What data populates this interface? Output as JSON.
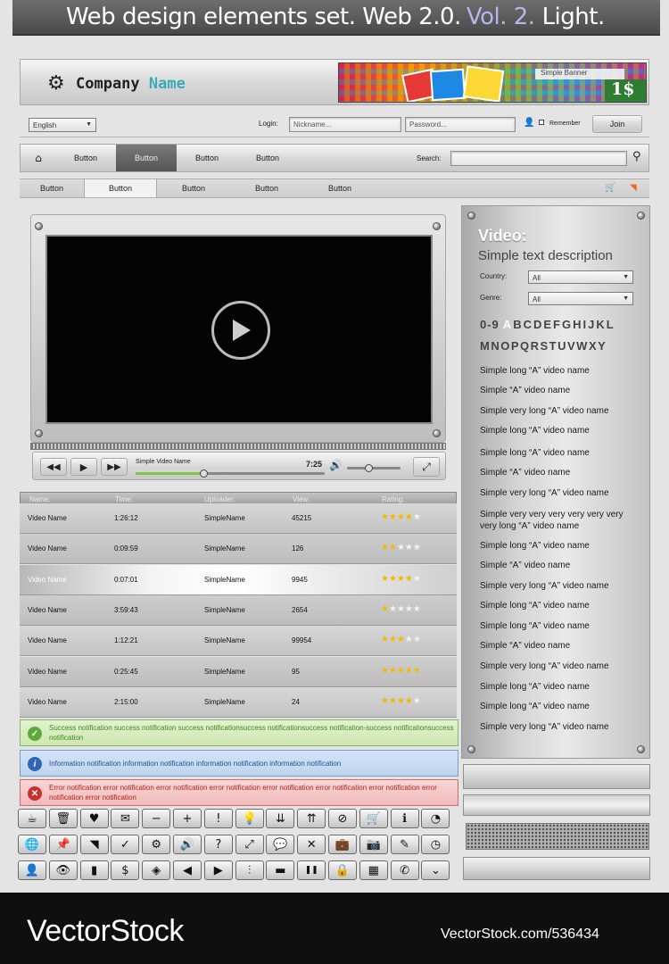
{
  "header": {
    "title_main": "Web design elements set. Web 2.0.",
    "title_vol": "Vol. 2.",
    "title_end": "Light."
  },
  "brand": {
    "company": "Company",
    "name": "Name",
    "banner_label": "Simple Banner",
    "banner_price": "1$"
  },
  "topbar": {
    "language": "English",
    "login_label": "Login:",
    "nickname_placeholder": "Nickname...",
    "password_placeholder": "Password...",
    "remember_label": "Remember",
    "join_label": "Join"
  },
  "nav1": {
    "items": [
      "Button",
      "Button",
      "Button",
      "Button"
    ],
    "active_index": 1,
    "search_label": "Search:"
  },
  "nav2": {
    "items": [
      "Button",
      "Button",
      "Button",
      "Button",
      "Button"
    ],
    "active_index": 1
  },
  "player": {
    "video_title": "Simple Video Name",
    "time": "7:25",
    "progress": 0.36,
    "volume": 0.4
  },
  "table": {
    "headers": [
      "Name:",
      "Time:",
      "Uploader:",
      "View:",
      "Rating:"
    ],
    "rows": [
      {
        "name": "Video Name",
        "time": "1:26:12",
        "uploader": "SimpleName",
        "views": "45215",
        "rating": 4
      },
      {
        "name": "Video Name",
        "time": "0:09:59",
        "uploader": "SimpleName",
        "views": "126",
        "rating": 2
      },
      {
        "name": "Video Name",
        "time": "0:07:01",
        "uploader": "SimpleName",
        "views": "9945",
        "rating": 4
      },
      {
        "name": "Video Name",
        "time": "3:59:43",
        "uploader": "SimpleName",
        "views": "2654",
        "rating": 1
      },
      {
        "name": "Video Name",
        "time": "1:12:21",
        "uploader": "SimpleName",
        "views": "99954",
        "rating": 3
      },
      {
        "name": "Video Name",
        "time": "0:25:45",
        "uploader": "SimpleName",
        "views": "95",
        "rating": 5
      },
      {
        "name": "Video Name",
        "time": "2:15:00",
        "uploader": "SimpleName",
        "views": "24",
        "rating": 4
      }
    ],
    "highlight_index": 2
  },
  "notifications": {
    "success": "Success notification success notification success notificationsuccess notificationsuccess notification-success notificationsuccess notification",
    "info": "Information notification information notification information notification information notification",
    "error": "Error notification error notification error notification error notification error notification error notification error notification error notification error notification"
  },
  "sidebar": {
    "heading": "Video:",
    "subheading": "Simple text description",
    "country_label": "Country:",
    "country_value": "All",
    "genre_label": "Genre:",
    "genre_value": "All",
    "alphabet_line1": [
      "0-9",
      "A",
      "B",
      "C",
      "D",
      "E",
      "F",
      "G",
      "H",
      "I",
      "J",
      "K",
      "L"
    ],
    "alphabet_line2": "MNOPQRSTUVWXY",
    "active_letter": "A",
    "videos": [
      "Simple long “A” video name",
      "Simple  “A” video name",
      "Simple very long “A” video name",
      "Simple long “A” video name",
      "Simple long “A” video name",
      "Simple  “A” video name",
      "Simple very long “A” video name",
      "Simple very very very very very very very long “A” video name",
      "Simple long “A” video name",
      "Simple  “A” video name",
      "Simple very long “A” video name",
      "Simple long “A” video name",
      "Simple long “A” video name",
      "Simple  “A” video name",
      "Simple very long “A” video name",
      "Simple long “A” video name",
      "Simple long “A” video name",
      "Simple very long “A” video name"
    ]
  },
  "icons": {
    "row1": [
      "coffee-icon",
      "trash-icon",
      "heart-icon",
      "mail-icon",
      "minus-icon",
      "plus-icon",
      "exclamation-icon",
      "lightbulb-icon",
      "chevron-double-down-icon",
      "chevron-double-up-icon",
      "forbidden-icon",
      "cart-icon",
      "info-icon",
      "pie-chart-icon"
    ],
    "row2": [
      "globe-icon",
      "pin-icon",
      "rss-icon",
      "check-icon",
      "settings-icon",
      "speaker-icon",
      "question-icon",
      "expand-icon",
      "chat-icon",
      "close-icon",
      "briefcase-icon",
      "camera-icon",
      "pencil-icon",
      "clock-icon"
    ],
    "row3": [
      "user-icon",
      "eye-icon",
      "bar-chart-icon",
      "dollar-icon",
      "tag-icon",
      "arrow-left-icon",
      "arrow-right-icon",
      "equalizer-icon",
      "folder-icon",
      "pause-icon",
      "lock-icon",
      "calculator-icon",
      "phone-icon",
      "chevron-circle-down-icon"
    ]
  },
  "footer": {
    "watermark_left": "VectorStock",
    "watermark_right": "VectorStock.com/536434"
  }
}
